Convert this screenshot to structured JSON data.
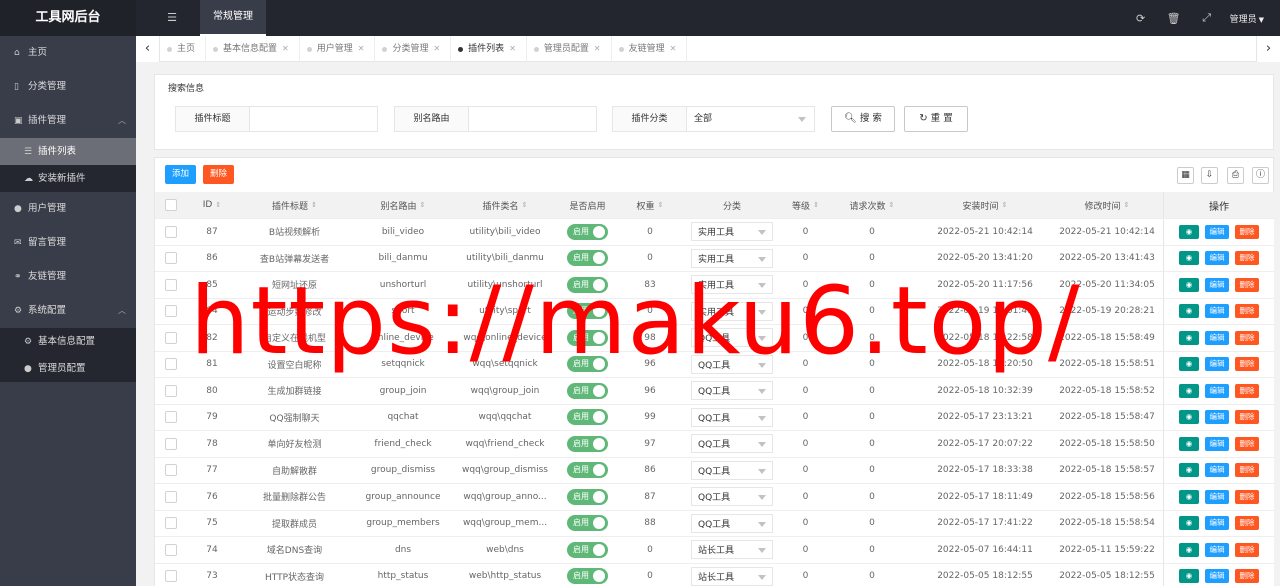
{
  "header": {
    "logo": "工具网后台",
    "module": "常规管理",
    "admin": "管理员"
  },
  "sidebar": {
    "items": [
      {
        "label": "主页",
        "icon": "home-icon"
      },
      {
        "label": "分类管理",
        "icon": "bookmark-icon"
      },
      {
        "label": "插件管理",
        "icon": "plugin-icon",
        "expanded": true
      },
      {
        "label": "插件列表",
        "icon": "list-icon",
        "sub": true,
        "active": true
      },
      {
        "label": "安装新插件",
        "icon": "cloud-upload-icon",
        "sub": true
      },
      {
        "label": "用户管理",
        "icon": "user-icon"
      },
      {
        "label": "留言管理",
        "icon": "comments-icon"
      },
      {
        "label": "友链管理",
        "icon": "link-icon"
      },
      {
        "label": "系统配置",
        "icon": "cogs-icon",
        "expanded": true
      },
      {
        "label": "基本信息配置",
        "icon": "gear-icon",
        "sub": true
      },
      {
        "label": "管理员配置",
        "icon": "user-icon",
        "sub": true
      }
    ]
  },
  "tabs": [
    {
      "label": "主页",
      "closable": false
    },
    {
      "label": "基本信息配置",
      "closable": true
    },
    {
      "label": "用户管理",
      "closable": true
    },
    {
      "label": "分类管理",
      "closable": true
    },
    {
      "label": "插件列表",
      "closable": true,
      "active": true
    },
    {
      "label": "管理员配置",
      "closable": true
    },
    {
      "label": "友链管理",
      "closable": true
    }
  ],
  "search": {
    "title": "搜索信息",
    "title_label": "插件标题",
    "alias_label": "别名路由",
    "category_label": "插件分类",
    "category_value": "全部",
    "search_button": "搜 索",
    "reset_button": "重 置"
  },
  "toolbar": {
    "add_label": "添加",
    "delete_label": "删除"
  },
  "table": {
    "columns": [
      "ID",
      "插件标题",
      "别名路由",
      "插件类名",
      "是否启用",
      "权重",
      "分类",
      "等级",
      "请求次数",
      "安装时间",
      "修改时间",
      "操作"
    ],
    "switch_on_text": "启用",
    "op_view": "◉",
    "op_edit": "编辑",
    "op_delete": "删除",
    "rows": [
      {
        "id": "87",
        "title": "B站视频解析",
        "alias": "bili_video",
        "class": "utility\\bili_video",
        "weight": "0",
        "category": "实用工具",
        "level": "0",
        "requests": "0",
        "installed": "2022-05-21 10:42:14",
        "modified": "2022-05-21 10:42:14"
      },
      {
        "id": "86",
        "title": "查B站弹幕发送者",
        "alias": "bili_danmu",
        "class": "utility\\bili_danmu",
        "weight": "0",
        "category": "实用工具",
        "level": "0",
        "requests": "0",
        "installed": "2022-05-20 13:41:20",
        "modified": "2022-05-20 13:41:43"
      },
      {
        "id": "85",
        "title": "短网址还原",
        "alias": "unshorturl",
        "class": "utility\\unshorturl",
        "weight": "83",
        "category": "实用工具",
        "level": "0",
        "requests": "0",
        "installed": "2022-05-20 11:17:56",
        "modified": "2022-05-20 11:34:05"
      },
      {
        "id": "84",
        "title": "运动步数修改",
        "alias": "sport",
        "class": "utility\\sport",
        "weight": "0",
        "category": "实用工具",
        "level": "0",
        "requests": "0",
        "installed": "2022-05-19 17:01:41",
        "modified": "2022-05-19 20:28:21"
      },
      {
        "id": "82",
        "title": "自定义在线机型",
        "alias": "online_device",
        "class": "wqq\\online_device",
        "weight": "98",
        "category": "QQ工具",
        "level": "0",
        "requests": "0",
        "installed": "2022-05-18 12:22:58",
        "modified": "2022-05-18 15:58:49"
      },
      {
        "id": "81",
        "title": "设置空白昵称",
        "alias": "setqqnick",
        "class": "wqq\\setqqnick",
        "weight": "96",
        "category": "QQ工具",
        "level": "0",
        "requests": "0",
        "installed": "2022-05-18 11:20:50",
        "modified": "2022-05-18 15:58:51"
      },
      {
        "id": "80",
        "title": "生成加群链接",
        "alias": "group_join",
        "class": "wqq\\group_join",
        "weight": "96",
        "category": "QQ工具",
        "level": "0",
        "requests": "0",
        "installed": "2022-05-18 10:32:39",
        "modified": "2022-05-18 15:58:52"
      },
      {
        "id": "79",
        "title": "QQ强制聊天",
        "alias": "qqchat",
        "class": "wqq\\qqchat",
        "weight": "99",
        "category": "QQ工具",
        "level": "0",
        "requests": "0",
        "installed": "2022-05-17 23:13:21",
        "modified": "2022-05-18 15:58:47"
      },
      {
        "id": "78",
        "title": "单向好友检测",
        "alias": "friend_check",
        "class": "wqq\\friend_check",
        "weight": "97",
        "category": "QQ工具",
        "level": "0",
        "requests": "0",
        "installed": "2022-05-17 20:07:22",
        "modified": "2022-05-18 15:58:50"
      },
      {
        "id": "77",
        "title": "自助解散群",
        "alias": "group_dismiss",
        "class": "wqq\\group_dismiss",
        "weight": "86",
        "category": "QQ工具",
        "level": "0",
        "requests": "0",
        "installed": "2022-05-17 18:33:38",
        "modified": "2022-05-18 15:58:57"
      },
      {
        "id": "76",
        "title": "批量删除群公告",
        "alias": "group_announce",
        "class": "wqq\\group_anno...",
        "weight": "87",
        "category": "QQ工具",
        "level": "0",
        "requests": "0",
        "installed": "2022-05-17 18:11:49",
        "modified": "2022-05-18 15:58:56"
      },
      {
        "id": "75",
        "title": "提取群成员",
        "alias": "group_members",
        "class": "wqq\\group_mem...",
        "weight": "88",
        "category": "QQ工具",
        "level": "0",
        "requests": "0",
        "installed": "2022-05-17 17:41:22",
        "modified": "2022-05-18 15:58:54"
      },
      {
        "id": "74",
        "title": "域名DNS查询",
        "alias": "dns",
        "class": "web\\dns",
        "weight": "0",
        "category": "站长工具",
        "level": "0",
        "requests": "0",
        "installed": "2022-05-07 16:44:11",
        "modified": "2022-05-11 15:59:22"
      },
      {
        "id": "73",
        "title": "HTTP状态查询",
        "alias": "http_status",
        "class": "web\\http_status",
        "weight": "0",
        "category": "站长工具",
        "level": "0",
        "requests": "0",
        "installed": "2022-05-05 18:12:55",
        "modified": "2022-05-05 18:12:55"
      }
    ]
  },
  "watermark": "https://maku6.top/"
}
